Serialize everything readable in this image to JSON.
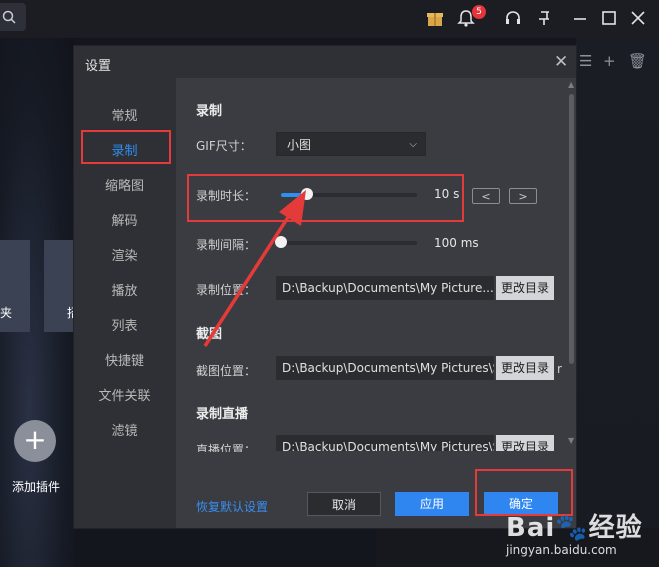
{
  "app": {
    "bell_badge": "5",
    "tile_left_label": "夹",
    "tile_right_label": "招",
    "add_plugin_label": "添加插件",
    "add_plugin_symbol": "+",
    "toolbar_right": [
      "☰",
      "+",
      "🗑"
    ]
  },
  "dialog": {
    "title": "设置",
    "close_symbol": "✕",
    "nav": [
      {
        "label": "常规",
        "active": false
      },
      {
        "label": "录制",
        "active": true
      },
      {
        "label": "缩略图",
        "active": false
      },
      {
        "label": "解码",
        "active": false
      },
      {
        "label": "渲染",
        "active": false
      },
      {
        "label": "播放",
        "active": false
      },
      {
        "label": "列表",
        "active": false
      },
      {
        "label": "快捷键",
        "active": false
      },
      {
        "label": "文件关联",
        "active": false
      },
      {
        "label": "滤镜",
        "active": false
      }
    ],
    "record": {
      "section_title": "录制",
      "gif_size_label": "GIF尺寸：",
      "gif_size_value": "小图",
      "duration_label": "录制时长：",
      "duration_value": "10 s",
      "duration_fraction": 0.19,
      "step_prev": "<",
      "step_next": ">",
      "interval_label": "录制间隔：",
      "interval_value": "100 ms",
      "interval_fraction": 0.0,
      "location_label": "录制位置：",
      "location_path": "D:\\Backup\\Documents\\My Picture...",
      "change_dir": "更改目录"
    },
    "screenshot": {
      "section_title": "截图",
      "location_label": "截图位置：",
      "location_path": "D:\\Backup\\Documents\\My Pictures\\S",
      "change_dir": "更改目录",
      "overflow_char": "r"
    },
    "live": {
      "section_title": "录制直播",
      "location_label": "直播位置：",
      "location_path": "D:\\Backup\\Documents\\My Pictures\\S",
      "change_dir": "更改目录"
    },
    "footer": {
      "restore": "恢复默认设置",
      "cancel": "取消",
      "apply": "应用",
      "ok": "确定"
    }
  },
  "watermark": {
    "main": "Bai🐾经验",
    "sub": "jingyan.baidu.com"
  },
  "colors": {
    "accent": "#2f8ff0",
    "annotation": "#e53a3a"
  }
}
